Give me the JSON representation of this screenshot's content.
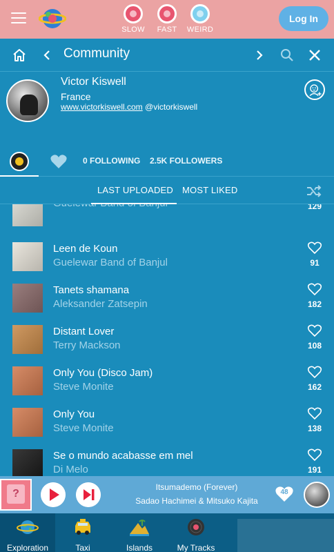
{
  "header": {
    "moods": [
      {
        "label": "SLOW",
        "color": "#e8546f"
      },
      {
        "label": "FAST",
        "color": "#e8546f"
      },
      {
        "label": "WEIRD",
        "color": "#7fd0ee"
      }
    ],
    "login_label": "Log In"
  },
  "nav": {
    "title": "Community"
  },
  "profile": {
    "name": "Victor Kiswell",
    "country": "France",
    "website": "www.victorkiswell.com",
    "handle": "@victorkiswell"
  },
  "stats": {
    "following": "0 FOLLOWING",
    "followers": "2.5K FOLLOWERS"
  },
  "sort_tabs": {
    "last_uploaded": "LAST UPLOADED",
    "most_liked": "MOST LIKED",
    "active": "LAST UPLOADED"
  },
  "tracks": [
    {
      "title": "",
      "artist": "Guelewar Band of Banjul",
      "likes": "129",
      "cover_color": "#d8d8d0"
    },
    {
      "title": "Leen de Koun",
      "artist": "Guelewar Band of Banjul",
      "likes": "91",
      "cover_color": "#e6e2d8"
    },
    {
      "title": "Tanets shamana",
      "artist": "Aleksander Zatsepin",
      "likes": "182",
      "cover_color": "#8a6a6a"
    },
    {
      "title": "Distant Lover",
      "artist": "Terry Mackson",
      "likes": "108",
      "cover_color": "#c88a4a"
    },
    {
      "title": "Only You (Disco Jam)",
      "artist": "Steve Monite",
      "likes": "162",
      "cover_color": "#d07a50"
    },
    {
      "title": "Only You",
      "artist": "Steve Monite",
      "likes": "138",
      "cover_color": "#d07a50"
    },
    {
      "title": "Se o mundo acabasse em mel",
      "artist": "Di Melo",
      "likes": "191",
      "cover_color": "#1a1a1a"
    }
  ],
  "player": {
    "track_title": "Itsumademo (Forever)",
    "track_artist": "Sadao Hachimei & Mitsuko Kajita",
    "likes": "48",
    "cover_glyph": "?"
  },
  "bottom_nav": [
    {
      "label": "Exploration",
      "icon": "globe-icon",
      "active": true
    },
    {
      "label": "Taxi",
      "icon": "taxi-icon",
      "active": false
    },
    {
      "label": "Islands",
      "icon": "island-icon",
      "active": false
    },
    {
      "label": "My Tracks",
      "icon": "records-icon",
      "active": false
    }
  ]
}
